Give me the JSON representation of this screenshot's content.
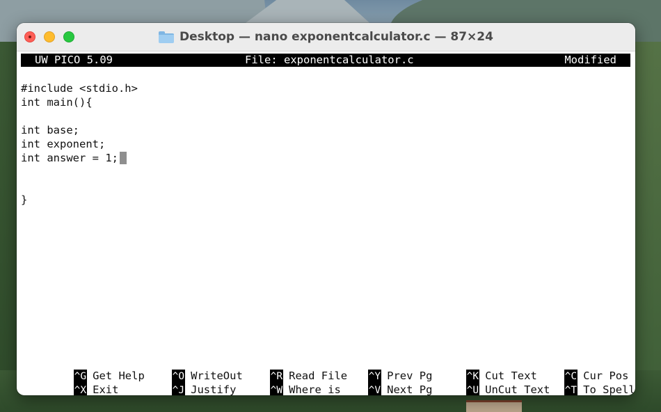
{
  "window": {
    "title": "Desktop — nano exponentcalculator.c — 87×24"
  },
  "editor": {
    "version": "UW PICO 5.09",
    "file_label": "File: exponentcalculator.c",
    "state": "Modified",
    "lines": [
      "#include <stdio.h>",
      "int main(){",
      "",
      "int base;",
      "int exponent;",
      "int answer = 1;",
      "",
      "",
      "}"
    ]
  },
  "shortcuts": [
    {
      "key": "^G",
      "label": "Get Help"
    },
    {
      "key": "^O",
      "label": "WriteOut"
    },
    {
      "key": "^R",
      "label": "Read File"
    },
    {
      "key": "^Y",
      "label": "Prev Pg"
    },
    {
      "key": "^K",
      "label": "Cut Text"
    },
    {
      "key": "^C",
      "label": "Cur Pos"
    },
    {
      "key": "^X",
      "label": "Exit"
    },
    {
      "key": "^J",
      "label": "Justify"
    },
    {
      "key": "^W",
      "label": "Where is"
    },
    {
      "key": "^V",
      "label": "Next Pg"
    },
    {
      "key": "^U",
      "label": "UnCut Text"
    },
    {
      "key": "^T",
      "label": "To Spell"
    }
  ],
  "colors": {
    "close": "#ff5f57",
    "minimize": "#febc2e",
    "maximize": "#28c840",
    "status_bar": "#000000",
    "cursor": "#8f8f8f"
  }
}
